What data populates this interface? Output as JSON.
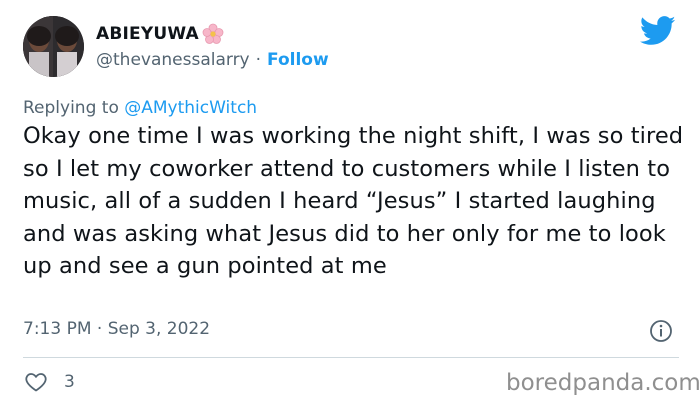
{
  "author": {
    "display_name": "ABIEYUWA",
    "handle": "@thevanessalarry",
    "separator": "·",
    "follow_label": "Follow",
    "emoji": "cherry-blossom-icon"
  },
  "reply": {
    "prefix": "Replying to",
    "mention": "@AMythicWitch"
  },
  "tweet": {
    "text": "Okay one time I was working the night shift, I was so tired so I let my coworker attend to customers while I listen to music, all of a sudden I heard “Jesus” I started laughing and was asking what Jesus did to her only for me to look up and see a gun pointed at me",
    "timestamp": "7:13 PM · Sep 3, 2022"
  },
  "stats": {
    "likes": "3"
  },
  "watermark": "boredpanda.com",
  "colors": {
    "accent": "#1d9bf0",
    "muted": "#536471",
    "text": "#0f1419"
  }
}
